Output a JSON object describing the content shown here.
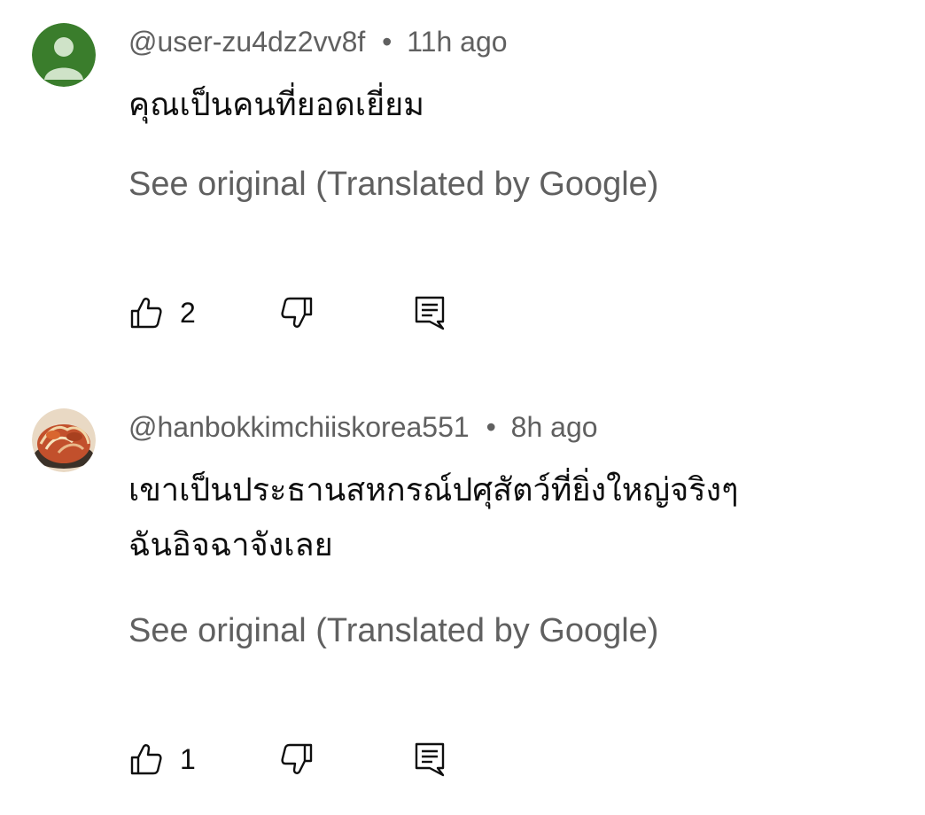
{
  "comments": [
    {
      "author": "@user-zu4dz2vv8f",
      "separator": "•",
      "time": "11h ago",
      "text_lines": [
        "คุณเป็นคนที่ยอดเยี่ยม"
      ],
      "see_original": "See original (Translated by Google)",
      "likes": "2",
      "avatar_icon": "default-user-avatar",
      "avatar_color": "#3a7d2c"
    },
    {
      "author": "@hanbokkimchiiskorea551",
      "separator": "•",
      "time": "8h ago",
      "text_lines": [
        "เขาเป็นประธานสหกรณ์ปศุสัตว์ที่ยิ่งใหญ่จริงๆ",
        "ฉันอิจฉาจังเลย"
      ],
      "see_original": "See original (Translated by Google)",
      "likes": "1",
      "avatar_icon": "kimchi-photo-avatar",
      "avatar_color": "#c2502c"
    }
  ],
  "icons": {
    "like": "thumbs-up-icon",
    "dislike": "thumbs-down-icon",
    "reply": "reply-comment-icon"
  }
}
